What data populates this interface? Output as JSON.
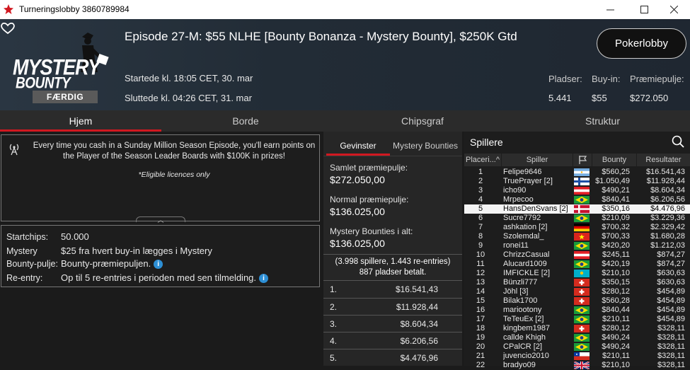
{
  "window": {
    "title": "Turneringslobby 3860789984"
  },
  "header": {
    "event_title": "Episode 27-M: $55 NLHE [Bounty Bonanza - Mystery Bounty], $250K Gtd",
    "brand_line1": "MYSTERY",
    "brand_line2": "BOUNTY",
    "status_badge": "FÆRDIG",
    "started": "Startede kl. 18:05 CET, 30. mar",
    "ended": "Sluttede kl. 04:26 CET, 31. mar",
    "lobby_button": "Pokerlobby",
    "stats": {
      "seats_label": "Pladser:",
      "seats_value": "5.441",
      "buyin_label": "Buy-in:",
      "buyin_value": "$55",
      "prize_label": "Præmiepulje:",
      "prize_value": "$272.050"
    }
  },
  "tabs": [
    "Hjem",
    "Borde",
    "Chipsgraf",
    "Struktur"
  ],
  "promo": {
    "text": "Every time you cash in a Sunday Million Season Episode, you'll earn points on the Player of the Season Leader Boards with $100K in prizes!",
    "note": "*Eligible licences only"
  },
  "details": {
    "startchips_label": "Startchips:",
    "startchips_value": "50.000",
    "mystery_label_1": "Mystery",
    "mystery_label_2": "Bounty-pulje:",
    "mystery_value_1": "$25 fra hvert buy-in lægges i Mystery",
    "mystery_value_2": "Bounty-præmiepuljen.",
    "reentry_label": "Re-entry:",
    "reentry_value": "Op til 5 re-entries i perioden med sen tilmelding."
  },
  "prizes": {
    "tabs": [
      "Gevinster",
      "Mystery Bounties"
    ],
    "total_label": "Samlet præmiepulje:",
    "total_value": "$272.050,00",
    "normal_label": "Normal præmiepulje:",
    "normal_value": "$136.025,00",
    "bounties_label": "Mystery Bounties i alt:",
    "bounties_value": "$136.025,00",
    "summary1": "(3.998 spillere, 1.443 re-entries)",
    "summary2": "887 pladser betalt.",
    "rows": [
      {
        "place": "1.",
        "amount": "$16.541,43"
      },
      {
        "place": "2.",
        "amount": "$11.928,44"
      },
      {
        "place": "3.",
        "amount": "$8.604,34"
      },
      {
        "place": "4.",
        "amount": "$6.206,56"
      },
      {
        "place": "5.",
        "amount": "$4.476,96"
      }
    ]
  },
  "players": {
    "title": "Spillere",
    "headers": {
      "place": "Placeri...",
      "player": "Spiller",
      "bounty": "Bounty",
      "result": "Resultater"
    },
    "rows": [
      {
        "place": "1",
        "name": "Felipe9646",
        "flag": "ar",
        "bounty": "$560,25",
        "result": "$16.541,43"
      },
      {
        "place": "2",
        "name": "TruePrayer [2]",
        "flag": "fi",
        "bounty": "$1.050,49",
        "result": "$11.928,44"
      },
      {
        "place": "3",
        "name": "icho90",
        "flag": "at",
        "bounty": "$490,21",
        "result": "$8.604,34"
      },
      {
        "place": "4",
        "name": "Mrpecoo",
        "flag": "br",
        "bounty": "$840,41",
        "result": "$6.206,56"
      },
      {
        "place": "5",
        "name": "HansDenSvans [2]",
        "flag": "dk",
        "bounty": "$350,16",
        "result": "$4.476,96"
      },
      {
        "place": "6",
        "name": "Sucre7792",
        "flag": "br",
        "bounty": "$210,09",
        "result": "$3.229,36"
      },
      {
        "place": "7",
        "name": "ashkation [2]",
        "flag": "de",
        "bounty": "$700,32",
        "result": "$2.329,42"
      },
      {
        "place": "8",
        "name": "Szolemdal_",
        "flag": "vn",
        "bounty": "$700,33",
        "result": "$1.680,28"
      },
      {
        "place": "9",
        "name": "ronei11",
        "flag": "br",
        "bounty": "$420,20",
        "result": "$1.212,03"
      },
      {
        "place": "10",
        "name": "ChrizzCasual",
        "flag": "at",
        "bounty": "$245,11",
        "result": "$874,27"
      },
      {
        "place": "11",
        "name": "Alucard1009",
        "flag": "br",
        "bounty": "$420,19",
        "result": "$874,27"
      },
      {
        "place": "12",
        "name": "IMFICKLE [2]",
        "flag": "kz",
        "bounty": "$210,10",
        "result": "$630,63"
      },
      {
        "place": "13",
        "name": "Bünzli777",
        "flag": "ch",
        "bounty": "$350,15",
        "result": "$630,63"
      },
      {
        "place": "14",
        "name": "Jöhl [3]",
        "flag": "ch",
        "bounty": "$280,12",
        "result": "$454,89"
      },
      {
        "place": "15",
        "name": "Bilak1700",
        "flag": "ch",
        "bounty": "$560,28",
        "result": "$454,89"
      },
      {
        "place": "16",
        "name": "mariootony",
        "flag": "br",
        "bounty": "$840,44",
        "result": "$454,89"
      },
      {
        "place": "17",
        "name": "TeTeuEx [2]",
        "flag": "br",
        "bounty": "$210,11",
        "result": "$454,89"
      },
      {
        "place": "18",
        "name": "kingbem1987",
        "flag": "ch",
        "bounty": "$280,12",
        "result": "$328,11"
      },
      {
        "place": "19",
        "name": "callde Khigh",
        "flag": "br",
        "bounty": "$490,24",
        "result": "$328,11"
      },
      {
        "place": "20",
        "name": "CPalCR [2]",
        "flag": "br",
        "bounty": "$490,24",
        "result": "$328,11"
      },
      {
        "place": "21",
        "name": "juvencio2010",
        "flag": "cl",
        "bounty": "$210,11",
        "result": "$328,11"
      },
      {
        "place": "22",
        "name": "bradyo09",
        "flag": "gb",
        "bounty": "$210,10",
        "result": "$328,11"
      }
    ],
    "selected_place": "5"
  },
  "colors": {
    "accent": "#d11820",
    "info": "#2d8fd5"
  }
}
